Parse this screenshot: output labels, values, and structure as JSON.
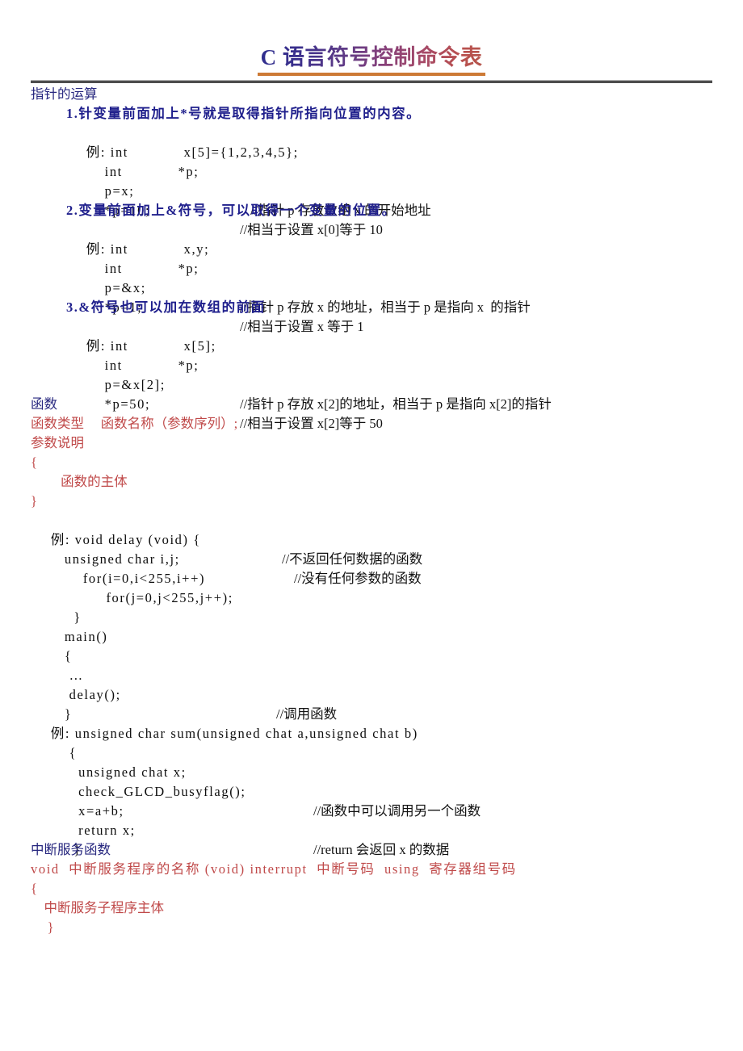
{
  "document": {
    "title": "C 语言符号控制命令表",
    "title_gradient_start": "#2f2f8f",
    "title_gradient_end": "#b4564a",
    "title_underline_color": "#cd7a35",
    "heading_color": "#27277f",
    "bold_heading_color": "#1f1f8c",
    "red_color": "#c04a4a",
    "body_color": "#0d0d0d"
  },
  "sections": {
    "pointer": {
      "heading": "指针的运算",
      "items": [
        {
          "number_title": "1.针变量前面加上*号就是取得指针所指向位置的内容。",
          "lines": [
            {
              "code": "例: int            x[5]={1,2,3,4,5};",
              "comment": ""
            },
            {
              "code": "    int            *p;",
              "comment": ""
            },
            {
              "code": "    p=x;",
              "comment": "//指针 p 存放数组 x 的开始地址"
            },
            {
              "code": "    *p=10;",
              "comment": "//相当于设置 x[0]等于 10"
            }
          ]
        },
        {
          "number_title": "2.变量前面加上&符号，可以取得一个变量的位置。",
          "lines": [
            {
              "code": "例: int            x,y;",
              "comment": ""
            },
            {
              "code": "    int            *p;",
              "comment": ""
            },
            {
              "code": "    p=&x;",
              "comment": "//指针 p 存放 x 的地址，相当于 p 是指向 x  的指针"
            },
            {
              "code": "    *p=1;",
              "comment": "//相当于设置 x 等于 1"
            }
          ]
        },
        {
          "number_title": "3.&符号也可以加在数组的前面",
          "lines": [
            {
              "code": "例: int            x[5];",
              "comment": ""
            },
            {
              "code": "    int            *p;",
              "comment": ""
            },
            {
              "code": "    p=&x[2];",
              "comment": "//指针 p 存放 x[2]的地址，相当于 p 是指向 x[2]的指针"
            },
            {
              "code": "    *p=50;",
              "comment": "//相当于设置 x[2]等于 50"
            }
          ]
        }
      ]
    },
    "function": {
      "heading": "函数",
      "template": [
        "函数类型     函数名称（参数序列）;",
        "参数说明",
        "{",
        "         函数的主体",
        "}"
      ],
      "example1": [
        {
          "code": "例: void delay (void) {",
          "comment": "//不返回任何数据的函数"
        },
        {
          "code": "   unsigned char i,j;",
          "comment": "//没有任何参数的函数"
        },
        {
          "code": "       for(i=0,i<255,i++)",
          "comment": ""
        },
        {
          "code": "            for(j=0,j<255,j++);",
          "comment": ""
        },
        {
          "code": "     }",
          "comment": ""
        },
        {
          "code": "   main()",
          "comment": ""
        },
        {
          "code": "   {",
          "comment": ""
        },
        {
          "code": "    …",
          "comment": ""
        },
        {
          "code": "    delay();",
          "comment": "//调用函数"
        },
        {
          "code": "   }",
          "comment": ""
        }
      ],
      "example2": [
        {
          "code": "例: unsigned char sum(unsigned chat a,unsigned chat b)",
          "comment": ""
        },
        {
          "code": "    {",
          "comment": ""
        },
        {
          "code": "      unsigned chat x;",
          "comment": ""
        },
        {
          "code": "      check_GLCD_busyflag();",
          "comment": "//函数中可以调用另一个函数"
        },
        {
          "code": "      x=a+b;",
          "comment": ""
        },
        {
          "code": "      return x;",
          "comment": "//return 会返回 x 的数据"
        },
        {
          "code": "     }",
          "comment": ""
        }
      ]
    },
    "interrupt": {
      "heading": "中断服务函数",
      "lines": [
        "void  中断服务程序的名称 (void) interrupt  中断号码  using  寄存器组号码",
        "{",
        "    中断服务子程序主体",
        "     }"
      ]
    }
  }
}
